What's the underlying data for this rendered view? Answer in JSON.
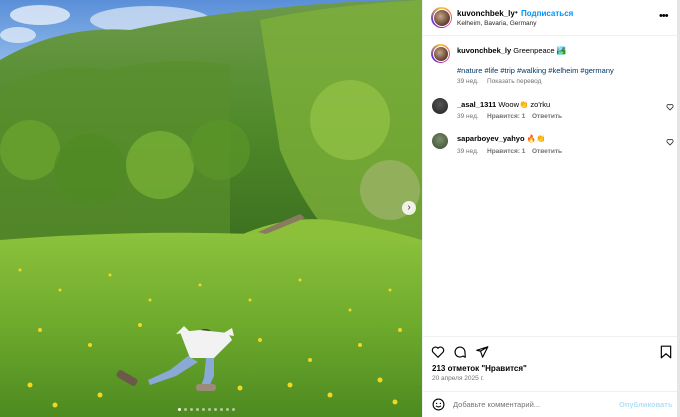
{
  "post": {
    "username": "kuvonchbek_ly",
    "follow_label": "Подписаться",
    "location": "Kelheim, Bavaria, Germany",
    "caption_user": "kuvonchbek_ly",
    "caption_text": "Greenpeace 🏞️",
    "hashtags": "#nature #life #trip #walking #kelheim #germany",
    "caption_age": "39 нед.",
    "show_translation": "Показать перевод",
    "likes": "213 отметок \"Нравится\"",
    "date": "20 апреля 2025 г.",
    "carousel": {
      "count": 10,
      "active_index": 0
    }
  },
  "comments": [
    {
      "username": "_asal_1311",
      "text": "Woow👏 zo'rku",
      "age": "39 нед.",
      "likes": "Нравится: 1",
      "reply": "Ответить"
    },
    {
      "username": "saparboyev_yahyo",
      "text": "🔥👏",
      "age": "39 нед.",
      "likes": "Нравится: 1",
      "reply": "Ответить"
    }
  ],
  "composer": {
    "placeholder": "Добавьте комментарий...",
    "post_label": "Опубликовать"
  },
  "icons": [
    "more-icon",
    "heart-icon",
    "comment-icon",
    "share-icon",
    "save-icon",
    "emoji-icon",
    "chevron-right-icon"
  ]
}
